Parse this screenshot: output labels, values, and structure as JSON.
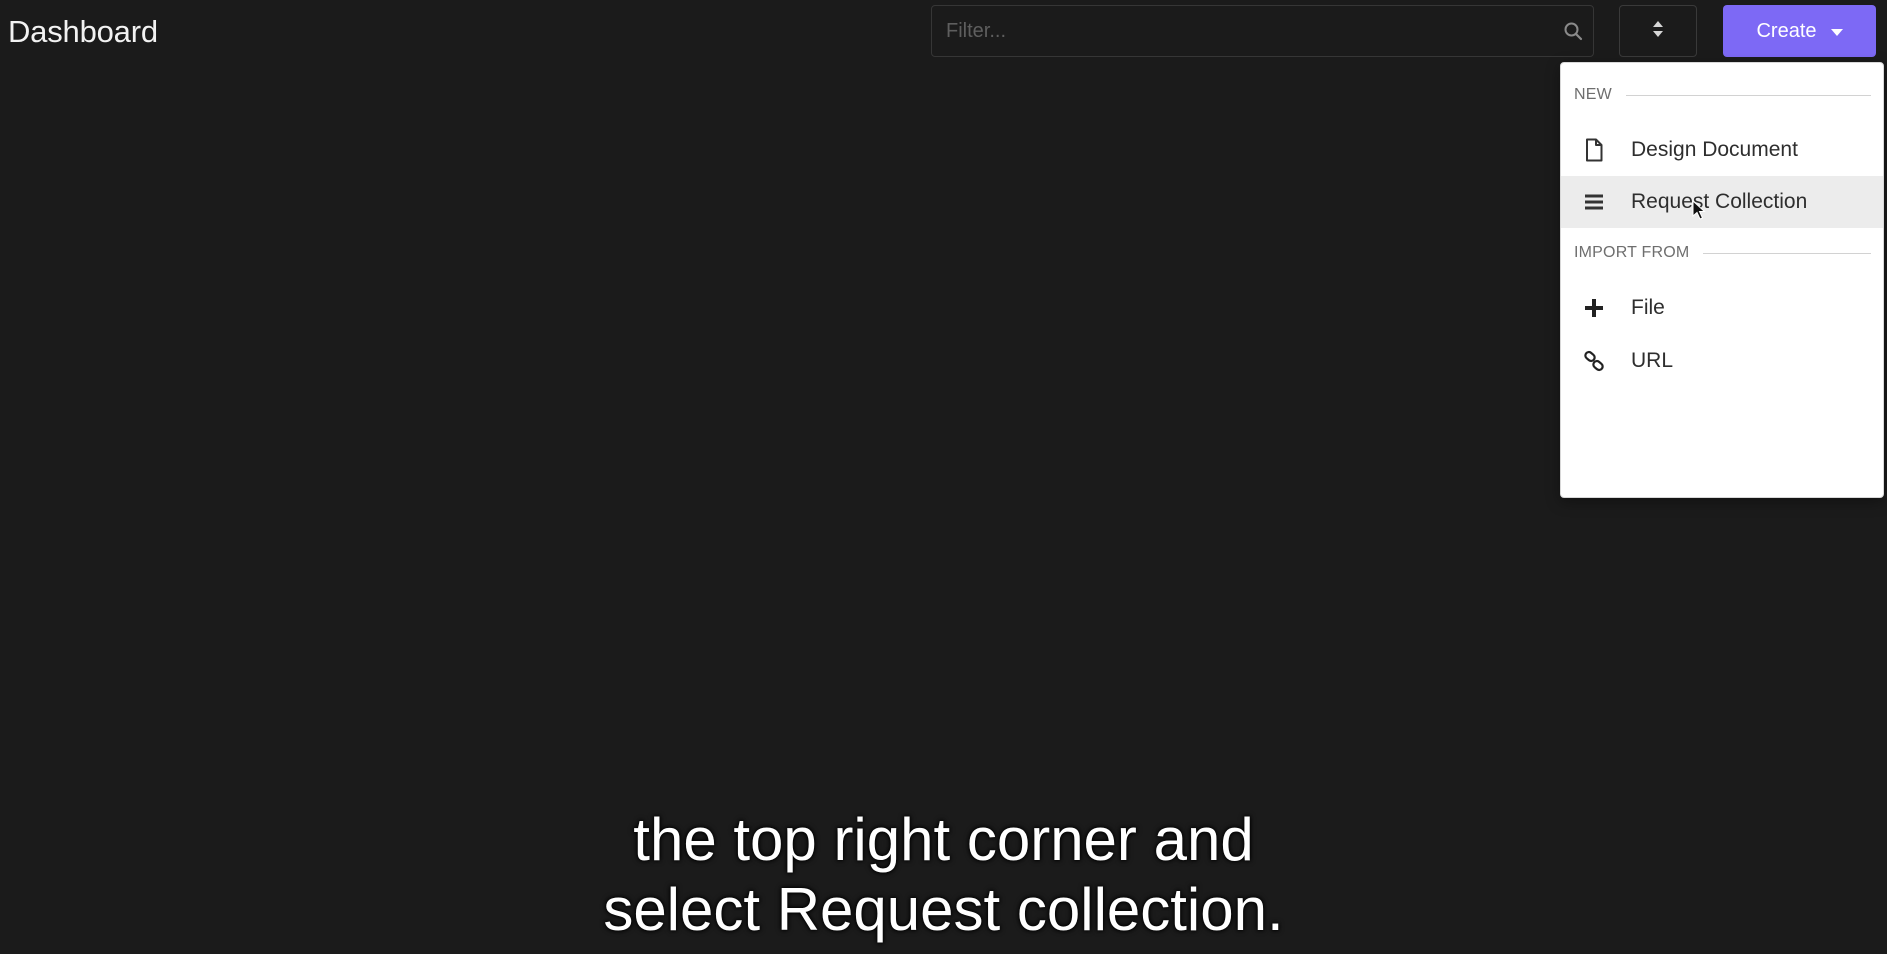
{
  "header": {
    "title": "Dashboard"
  },
  "filter": {
    "placeholder": "Filter...",
    "value": "",
    "icon": "search-icon"
  },
  "sort_button": {
    "icon": "sort-icon"
  },
  "create_button": {
    "label": "Create",
    "icon": "chevron-down-icon",
    "color": "#7d69f5"
  },
  "dropdown": {
    "sections": [
      {
        "title": "NEW",
        "items": [
          {
            "label": "Design Document",
            "icon": "document-icon"
          },
          {
            "label": "Request Collection",
            "icon": "menu-lines-icon",
            "hovered": true
          }
        ]
      },
      {
        "title": "IMPORT FROM",
        "items": [
          {
            "label": "File",
            "icon": "plus-icon"
          },
          {
            "label": "URL",
            "icon": "link-icon"
          }
        ]
      }
    ]
  },
  "subtitle": {
    "line1": "the top right corner and",
    "line2": "select Request collection."
  },
  "colors": {
    "background": "#1b1b1b",
    "accent": "#7d69f5",
    "menu_background": "#ffffff",
    "menu_hover": "#ececec"
  }
}
